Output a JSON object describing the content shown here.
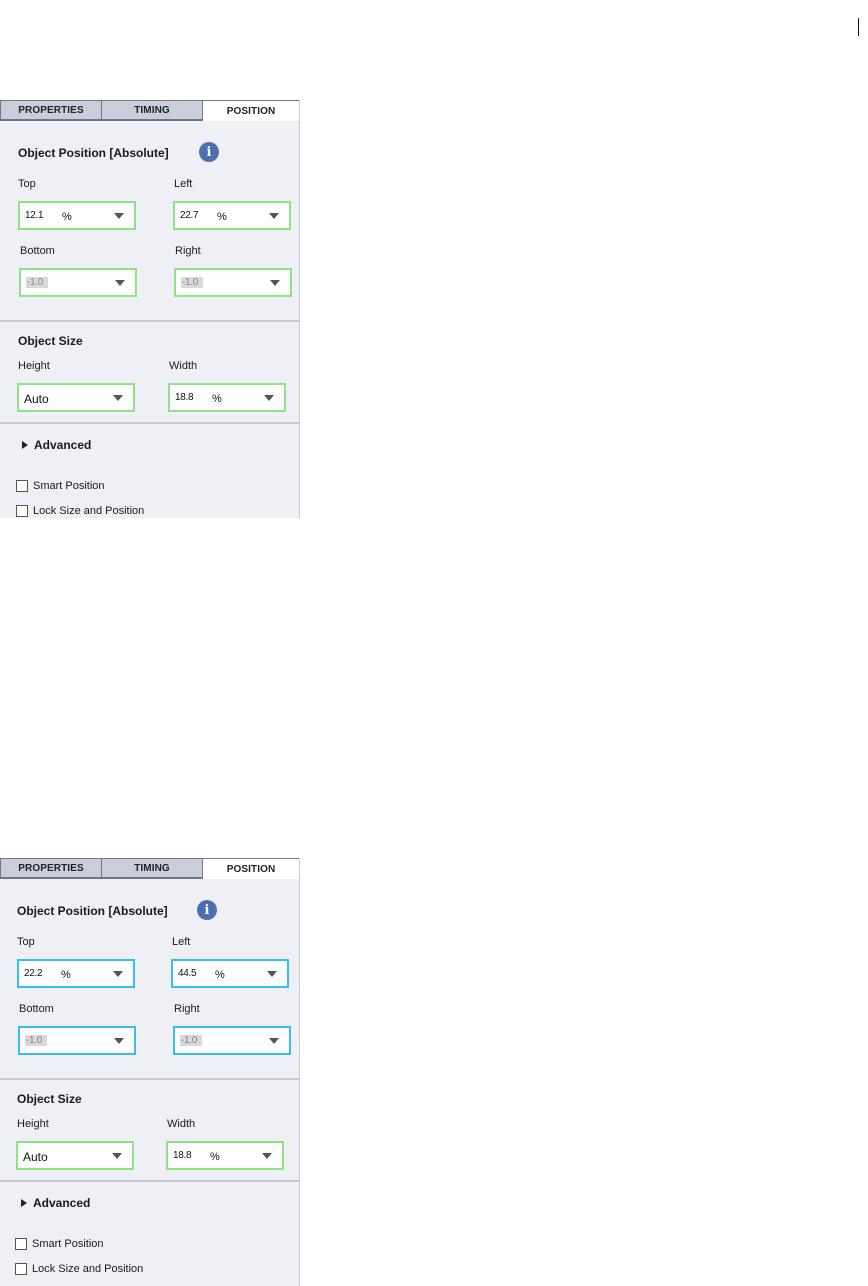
{
  "panels": [
    {
      "tabs": [
        "PROPERTIES",
        "TIMING",
        "POSITION"
      ],
      "active_tab": "POSITION",
      "position_heading": "Object Position [Absolute]",
      "info_icon": "i",
      "top_label": "Top",
      "top_value": "12.1",
      "top_unit": "%",
      "left_label": "Left",
      "left_value": "22.7",
      "left_unit": "%",
      "bottom_label": "Bottom",
      "bottom_value": "-1.0",
      "right_label": "Right",
      "right_value": "-1.0",
      "size_heading": "Object Size",
      "height_label": "Height",
      "height_value": "Auto",
      "width_label": "Width",
      "width_value": "18.8",
      "width_unit": "%",
      "advanced_label": "Advanced",
      "smart_position_label": "Smart Position",
      "lock_label": "Lock Size and Position",
      "position_field_color": "#8fe384",
      "size_field_color": "#8fe384"
    },
    {
      "tabs": [
        "PROPERTIES",
        "TIMING",
        "POSITION"
      ],
      "active_tab": "POSITION",
      "position_heading": "Object Position [Absolute]",
      "info_icon": "i",
      "top_label": "Top",
      "top_value": "22.2",
      "top_unit": "%",
      "left_label": "Left",
      "left_value": "44.5",
      "left_unit": "%",
      "bottom_label": "Bottom",
      "bottom_value": "-1.0",
      "right_label": "Right",
      "right_value": "-1.0",
      "size_heading": "Object Size",
      "height_label": "Height",
      "height_value": "Auto",
      "width_label": "Width",
      "width_value": "18.8",
      "width_unit": "%",
      "advanced_label": "Advanced",
      "smart_position_label": "Smart Position",
      "lock_label": "Lock Size and Position",
      "position_field_color": "#38bdf0",
      "size_field_color": "#8fe384"
    }
  ]
}
